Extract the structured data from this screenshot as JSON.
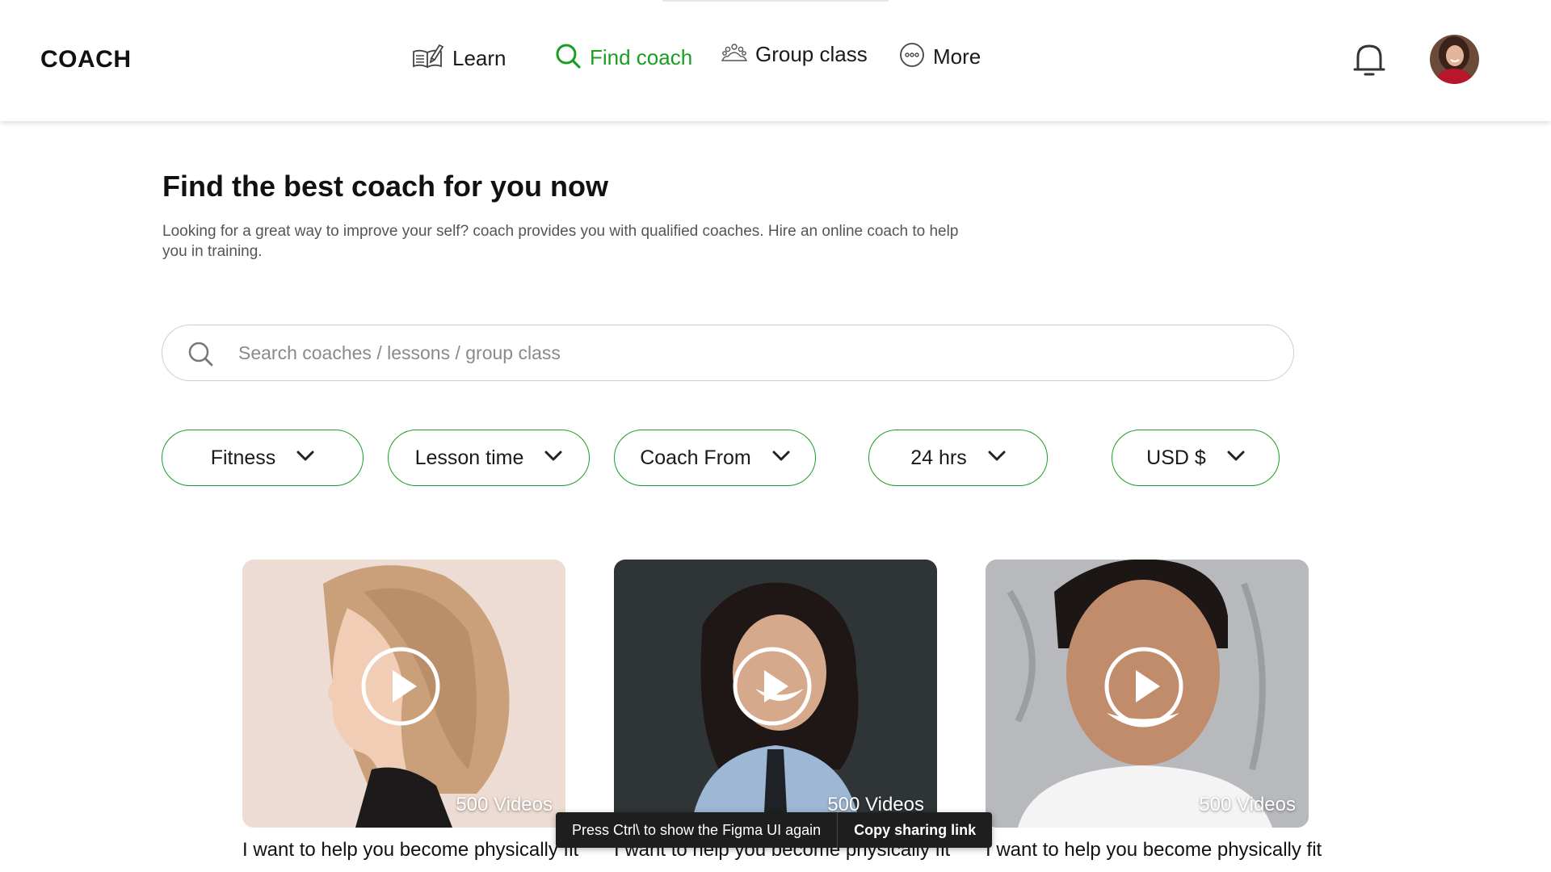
{
  "header": {
    "brand": "COACH",
    "nav": [
      {
        "label": "Learn",
        "icon": "book-write-icon",
        "active": false
      },
      {
        "label": "Find coach",
        "icon": "search-icon",
        "active": true
      },
      {
        "label": "Group class",
        "icon": "group-people-icon",
        "active": false
      },
      {
        "label": "More",
        "icon": "more-dots-icon",
        "active": false
      }
    ],
    "notification_icon": "bell-icon",
    "avatar_icon": "user-avatar"
  },
  "main": {
    "title": "Find the best coach for you now",
    "description": "Looking for a great way to improve your self? coach provides you with qualified coaches. Hire an online coach to help you in training."
  },
  "search": {
    "placeholder": "Search coaches / lessons / group class",
    "value": ""
  },
  "filters": [
    {
      "label": "Fitness"
    },
    {
      "label": "Lesson time"
    },
    {
      "label": "Coach From"
    },
    {
      "label": "24 hrs"
    },
    {
      "label": "USD $"
    }
  ],
  "cards": [
    {
      "videos": "500 Videos",
      "title": "I want to help you become physically fit"
    },
    {
      "videos": "500 Videos",
      "title": "I want to help you become physically fit"
    },
    {
      "videos": "500 Videos",
      "title": "I want to help you become physically fit"
    }
  ],
  "toast": {
    "message": "Press Ctrl\\ to show the Figma UI again",
    "action": "Copy sharing link"
  },
  "colors": {
    "accent": "#1a9e22",
    "text": "#111111",
    "muted": "#555555",
    "border": "#cfcfcf"
  }
}
